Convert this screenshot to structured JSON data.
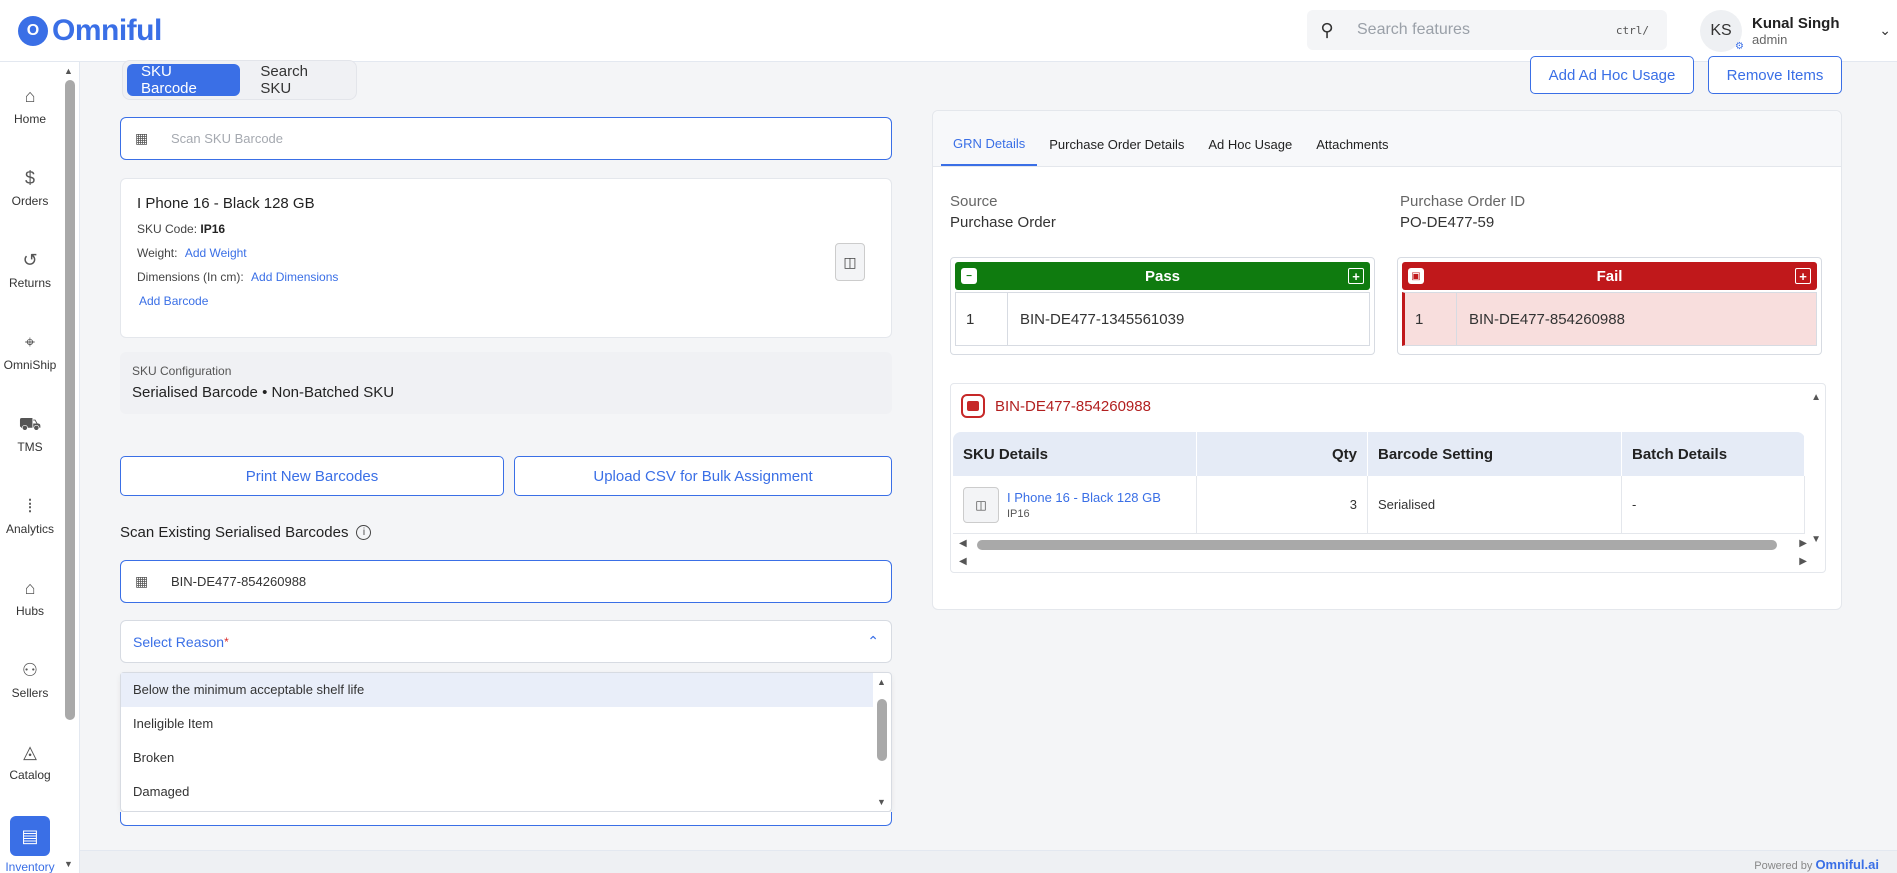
{
  "app": {
    "logo_text": "Omniful",
    "logo_mark": "O",
    "search_placeholder": "Search features",
    "search_shortcut": "ctrl/",
    "user": {
      "initials": "KS",
      "name": "Kunal Singh",
      "role": "admin"
    }
  },
  "sidebar": {
    "items": [
      {
        "label": "Home",
        "icon": "⌂"
      },
      {
        "label": "Orders",
        "icon": "$"
      },
      {
        "label": "Returns",
        "icon": "↺"
      },
      {
        "label": "OmniShip",
        "icon": "⌖"
      },
      {
        "label": "TMS",
        "icon": "⛟"
      },
      {
        "label": "Analytics",
        "icon": "⦙"
      },
      {
        "label": "Hubs",
        "icon": "⌂"
      },
      {
        "label": "Sellers",
        "icon": "⚇"
      },
      {
        "label": "Catalog",
        "icon": "◬"
      },
      {
        "label": "Inventory",
        "icon": "▤"
      }
    ]
  },
  "left": {
    "toggle": {
      "sku_barcode": "SKU Barcode",
      "search_sku": "Search SKU"
    },
    "scan_placeholder": "Scan SKU Barcode",
    "sku": {
      "title": "I Phone 16 - Black 128 GB",
      "code_label": "SKU Code:",
      "code": "IP16",
      "weight_label": "Weight:",
      "weight_link": "Add Weight",
      "dimensions_label": "Dimensions (In cm):",
      "dimensions_link": "Add Dimensions",
      "add_barcode": "Add Barcode"
    },
    "config": {
      "caption": "SKU Configuration",
      "value": "Serialised Barcode  •  Non-Batched SKU"
    },
    "print_btn": "Print New Barcodes",
    "upload_btn": "Upload CSV for Bulk Assignment",
    "scan_existing_label": "Scan Existing Serialised Barcodes",
    "scan_existing_value": "BIN-DE477-854260988",
    "select_reason": "Select Reason",
    "reasons": [
      "Below the minimum acceptable shelf life",
      "Ineligible Item",
      "Broken",
      "Damaged"
    ]
  },
  "right": {
    "add_adhoc_btn": "Add Ad Hoc Usage",
    "remove_items_btn": "Remove Items",
    "tabs": [
      "GRN Details",
      "Purchase Order Details",
      "Ad Hoc Usage",
      "Attachments"
    ],
    "source_label": "Source",
    "source_value": "Purchase Order",
    "po_label": "Purchase Order ID",
    "po_value": "PO-DE477-59",
    "pass": {
      "title": "Pass",
      "index": "1",
      "bin": "BIN-DE477-1345561039",
      "color": "#0f7b0f"
    },
    "fail": {
      "title": "Fail",
      "index": "1",
      "bin": "BIN-DE477-854260988",
      "color": "#c0181b"
    },
    "detail_bin": "BIN-DE477-854260988",
    "table": {
      "headers": [
        "SKU Details",
        "Qty",
        "Barcode Setting",
        "Batch Details"
      ],
      "row": {
        "name": "I Phone 16 - Black 128 GB",
        "code": "IP16",
        "qty": "3",
        "barcode_setting": "Serialised",
        "batch": "-"
      }
    }
  },
  "footer": {
    "powered_by": "Powered by",
    "brand": "Omniful.ai"
  }
}
